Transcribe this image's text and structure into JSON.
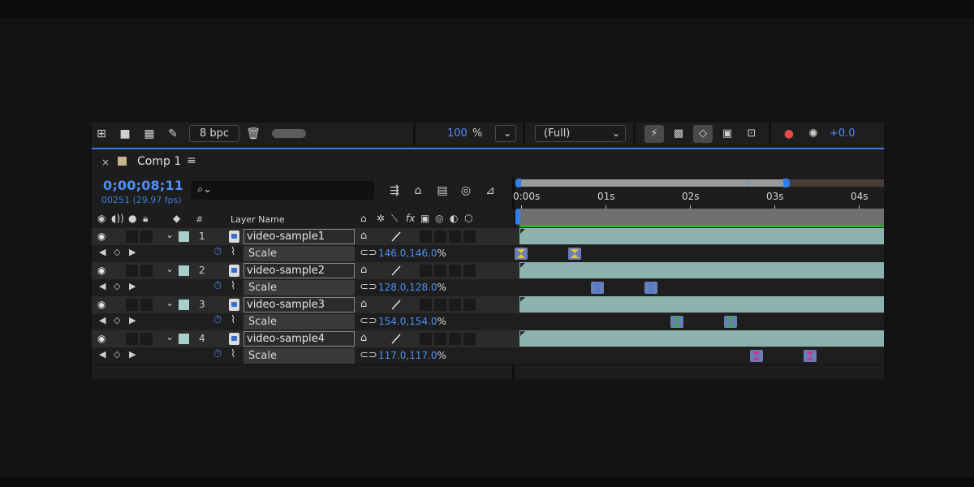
{
  "toolbar": {
    "bpc": "8 bpc",
    "zoom_value": "100",
    "zoom_unit": "%",
    "resolution": "(Full)",
    "exposure": "+0.0"
  },
  "panel": {
    "close": "×",
    "comp_name": "Comp 1",
    "comp_color": "#c8b48a"
  },
  "time": {
    "timecode": "0;00;08;11",
    "frames": "00251 (29.97 fps)"
  },
  "search": {
    "placeholder": ""
  },
  "ruler": {
    "ticks": [
      "0:00s",
      "01s",
      "02s",
      "03s",
      "04s"
    ]
  },
  "header": {
    "num": "#",
    "layer_name": "Layer Name"
  },
  "layers": [
    {
      "index": "1",
      "name": "video-sample1",
      "prop": "Scale",
      "value": "146.0,146.0",
      "unit": "%",
      "kf_color": "#e8c630"
    },
    {
      "index": "2",
      "name": "video-sample2",
      "prop": "Scale",
      "value": "128.0,128.0",
      "unit": "%",
      "kf_color": "#4b78d8"
    },
    {
      "index": "3",
      "name": "video-sample3",
      "prop": "Scale",
      "value": "154.0,154.0",
      "unit": "%",
      "kf_color": "#3fa44a"
    },
    {
      "index": "4",
      "name": "video-sample4",
      "prop": "Scale",
      "value": "117.0,117.0",
      "unit": "%",
      "kf_color": "#c2379a"
    }
  ],
  "colors": {
    "accent": "#4f8ff7",
    "layer_label": "#a8cfc9",
    "layer_bar": "#8cb3ad",
    "work_area": "#2f7ff0"
  }
}
